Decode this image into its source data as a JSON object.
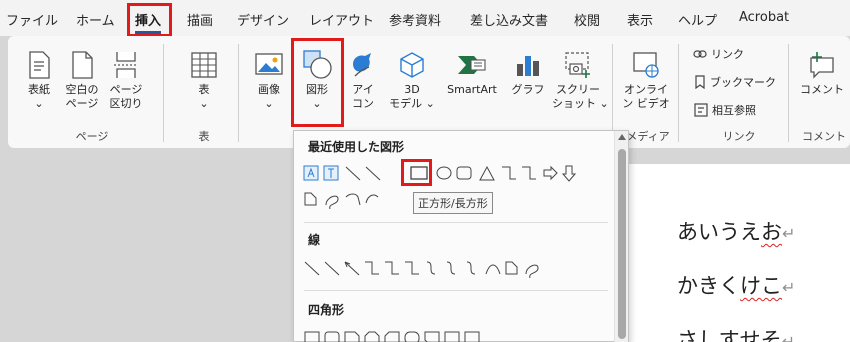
{
  "menubar": {
    "tabs": [
      "ファイル",
      "ホーム",
      "挿入",
      "描画",
      "デザイン",
      "レイアウト",
      "参考資料",
      "差し込み文書",
      "校閲",
      "表示",
      "ヘルプ",
      "Acrobat"
    ],
    "active": "挿入"
  },
  "ribbon": {
    "cover": [
      "表紙",
      "⌄"
    ],
    "blank": [
      "空白の",
      "ページ"
    ],
    "pagebreak": [
      "ページ",
      "区切り"
    ],
    "pages_group": "ページ",
    "table": [
      "表",
      "⌄"
    ],
    "table_group": "表",
    "image": [
      "画像",
      "⌄"
    ],
    "shapes": [
      "図形",
      "⌄"
    ],
    "icons": [
      "アイ",
      "コン"
    ],
    "model3d": [
      "3D",
      "モデル ⌄"
    ],
    "smartart": "SmartArt",
    "graph": "グラフ",
    "screenshot": [
      "スクリー",
      "ショット ⌄"
    ],
    "online_video": [
      "オンライ",
      "ン ビデオ"
    ],
    "media_group": "メディア",
    "link": "リンク",
    "bookmark": "ブックマーク",
    "crossref": "相互参照",
    "links_group": "リンク",
    "comment": "コメント",
    "comment_group": "コメント"
  },
  "dropdown": {
    "recent_title": "最近使用した図形",
    "lines_title": "線",
    "rect_title": "四角形",
    "tooltip": "正方形/長方形"
  },
  "doc": {
    "lines": [
      {
        "text": "あいうえ",
        "squiggle": "お"
      },
      {
        "text": "かきく",
        "squiggle": "けこ"
      },
      {
        "text": "さしす",
        "squiggle": "せそ"
      }
    ],
    "return_mark": "↵"
  },
  "colors": {
    "accent": "#2b579a",
    "highlight": "#e21a1a",
    "icon_blue": "#2b7cd3",
    "icon_green": "#217346"
  }
}
